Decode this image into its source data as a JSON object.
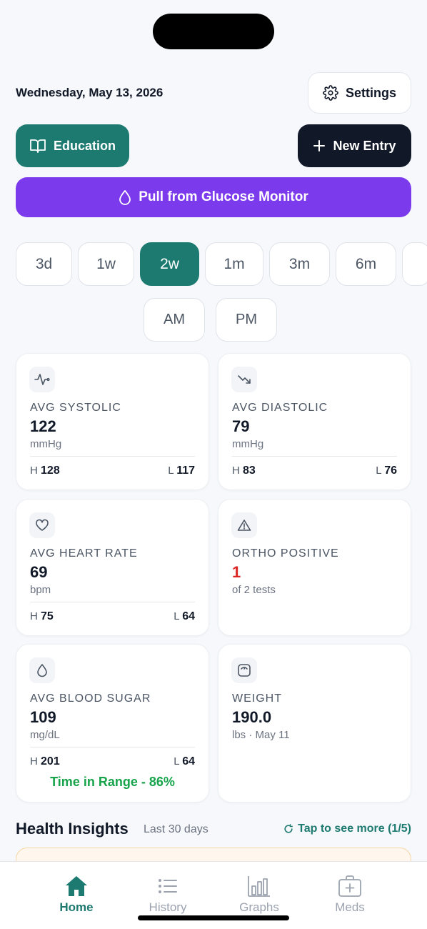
{
  "header": {
    "date": "Wednesday, May 13, 2026",
    "settings_label": "Settings"
  },
  "actions": {
    "education_label": "Education",
    "new_entry_label": "New Entry",
    "pull_label": "Pull from Glucose Monitor"
  },
  "ranges": [
    "3d",
    "1w",
    "2w",
    "1m",
    "3m",
    "6m"
  ],
  "active_range": "2w",
  "periods": [
    "AM",
    "PM"
  ],
  "cards": {
    "systolic": {
      "label": "AVG SYSTOLIC",
      "value": "122",
      "unit": "mmHg",
      "high_prefix": "H",
      "high": "128",
      "low_prefix": "L",
      "low": "117"
    },
    "diastolic": {
      "label": "AVG DIASTOLIC",
      "value": "79",
      "unit": "mmHg",
      "high_prefix": "H",
      "high": "83",
      "low_prefix": "L",
      "low": "76"
    },
    "heart_rate": {
      "label": "AVG HEART RATE",
      "value": "69",
      "unit": "bpm",
      "high_prefix": "H",
      "high": "75",
      "low_prefix": "L",
      "low": "64"
    },
    "ortho": {
      "label": "ORTHO POSITIVE",
      "value": "1",
      "unit": "of 2 tests"
    },
    "blood_sugar": {
      "label": "AVG BLOOD SUGAR",
      "value": "109",
      "unit": "mg/dL",
      "high_prefix": "H",
      "high": "201",
      "low_prefix": "L",
      "low": "64",
      "time_in_range": "Time in Range - 86%"
    },
    "weight": {
      "label": "WEIGHT",
      "value": "190.0",
      "unit": "lbs · May 11"
    }
  },
  "insights": {
    "title": "Health Insights",
    "subtitle": "Last 30 days",
    "more_label": "Tap to see more (1/5)"
  },
  "tabs": {
    "home": "Home",
    "history": "History",
    "graphs": "Graphs",
    "meds": "Meds"
  },
  "colors": {
    "accent": "#1d7a70",
    "dark": "#111827",
    "purple": "#7c3aed",
    "alert_red": "#dc2626",
    "in_range_green": "#16a34a"
  }
}
